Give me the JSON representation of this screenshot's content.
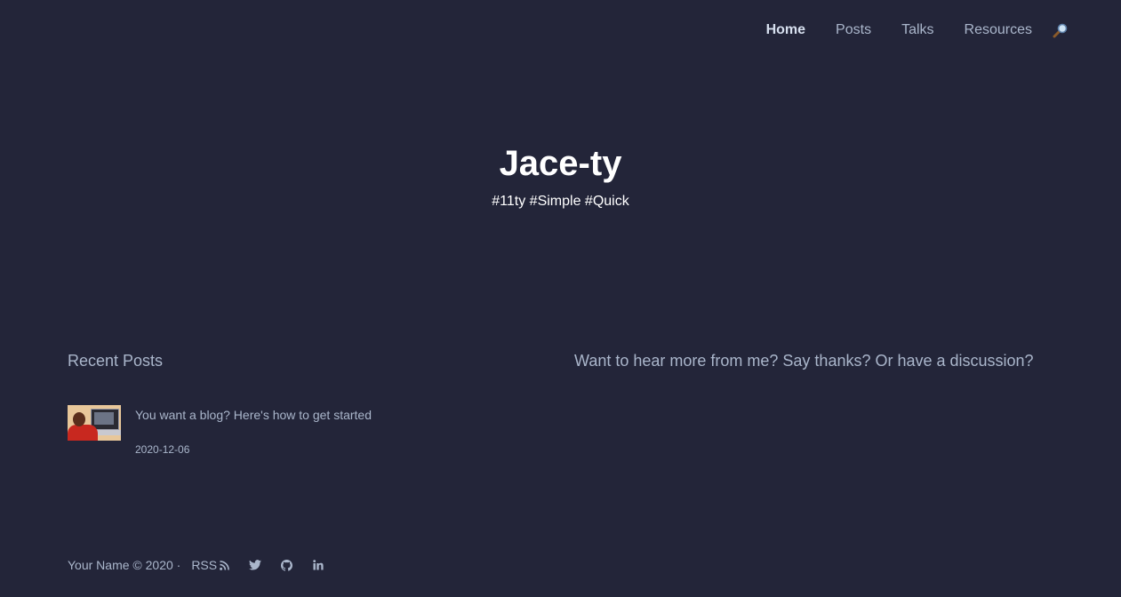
{
  "nav": {
    "items": [
      {
        "label": "Home",
        "active": true
      },
      {
        "label": "Posts",
        "active": false
      },
      {
        "label": "Talks",
        "active": false
      },
      {
        "label": "Resources",
        "active": false
      }
    ],
    "search_icon": "magnifier-icon"
  },
  "hero": {
    "title": "Jace-ty",
    "tagline": "#11ty #Simple #Quick"
  },
  "recent_posts": {
    "heading": "Recent Posts",
    "posts": [
      {
        "title": "You want a blog? Here's how to get started",
        "date": "2020-12-06"
      }
    ]
  },
  "cta": {
    "heading": "Want to hear more from me? Say thanks? Or have a discussion?"
  },
  "footer": {
    "copyright": "Your Name © 2020 ·",
    "rss_label": "RSS",
    "social_icons": [
      "twitter-icon",
      "github-icon",
      "linkedin-icon"
    ]
  },
  "colors": {
    "background": "#232539",
    "text": "#aab6cb",
    "heading": "#ffffff"
  }
}
